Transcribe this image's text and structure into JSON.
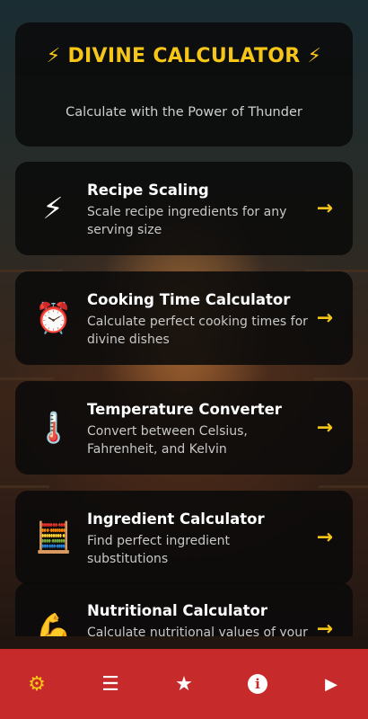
{
  "header": {
    "title": "⚡ DIVINE CALCULATOR ⚡",
    "subtitle": "Calculate with the Power of Thunder"
  },
  "cards": [
    {
      "icon": "⚡",
      "icon_name": "lightning-icon",
      "title": "Recipe Scaling",
      "description": "Scale recipe ingredients for any serving size"
    },
    {
      "icon": "⏰",
      "icon_name": "alarm-clock-icon",
      "title": "Cooking Time Calculator",
      "description": "Calculate perfect cooking times for divine dishes"
    },
    {
      "icon": "🌡️",
      "icon_name": "thermometer-icon",
      "title": "Temperature Converter",
      "description": "Convert between Celsius, Fahrenheit, and Kelvin"
    },
    {
      "icon": "🧮",
      "icon_name": "abacus-icon",
      "title": "Ingredient Calculator",
      "description": "Find perfect ingredient substitutions"
    },
    {
      "icon": "💪",
      "icon_name": "flexed-biceps-icon",
      "title": "Nutritional Calculator",
      "description": "Calculate nutritional values of your"
    }
  ],
  "arrow_glyph": "→",
  "bottom_nav": {
    "items": [
      {
        "name": "settings",
        "glyph": "⚙"
      },
      {
        "name": "menu",
        "glyph": "☰"
      },
      {
        "name": "favorites",
        "glyph": "★"
      },
      {
        "name": "info",
        "glyph": "i"
      },
      {
        "name": "play",
        "glyph": "▶"
      }
    ]
  },
  "colors": {
    "accent": "#f5c518",
    "nav_bar": "#c62a2a",
    "card_bg": "#0a0a0a"
  }
}
